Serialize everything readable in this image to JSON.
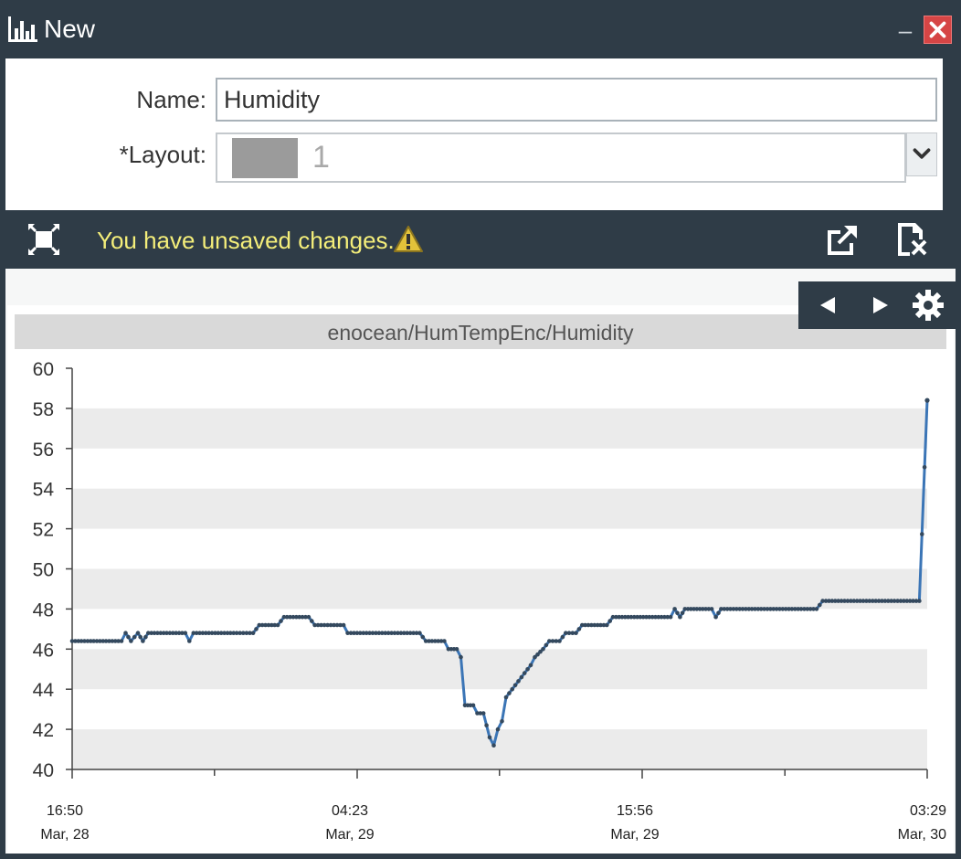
{
  "window": {
    "title": "New",
    "minimize_label": "–"
  },
  "form": {
    "name_label": "Name:",
    "name_value": "Humidity",
    "layout_label": "*Layout:",
    "layout_value": "1",
    "layout_swatch_color": "#9b9b9b"
  },
  "toolbar": {
    "unsaved_message": "You have unsaved changes."
  },
  "colors": {
    "chrome": "#2f3c47",
    "warning_text": "#f4ee7a",
    "close": "#d64545",
    "line": "#3b75b6",
    "point": "#34495e"
  },
  "icons": [
    "chart-icon",
    "close-icon",
    "expand-icon",
    "warning-icon",
    "export-icon",
    "discard-icon",
    "prev-icon",
    "next-icon",
    "gear-icon",
    "chevron-down-icon"
  ],
  "chart_data": {
    "type": "line",
    "title": "enocean/HumTempEnc/Humidity",
    "xlabel": "",
    "ylabel": "",
    "ylim": [
      40,
      60
    ],
    "yticks": [
      "40",
      "42",
      "44",
      "46",
      "48",
      "50",
      "52",
      "54",
      "56",
      "58",
      "60"
    ],
    "xlim": [
      "2024-03-28T16:50",
      "2024-03-30T03:29"
    ],
    "xticks": [
      {
        "time": "2024-03-28T16:50",
        "label": [
          "16:50",
          "Mar, 28"
        ]
      },
      {
        "time": "2024-03-29T04:23",
        "label": [
          "04:23",
          "Mar, 29"
        ]
      },
      {
        "time": "2024-03-29T15:56",
        "label": [
          "15:56",
          "Mar, 29"
        ]
      },
      {
        "time": "2024-03-30T03:29",
        "label": [
          "03:29",
          "Mar, 30"
        ]
      }
    ],
    "minor_xticks": [
      "2024-03-28T22:36",
      "2024-03-29T10:09",
      "2024-03-29T21:43"
    ],
    "grid": "alternating horizontal bands",
    "series": [
      {
        "points": [
          [
            "2024-03-28T16:50",
            46.4
          ],
          [
            "2024-03-28T18:50",
            46.4
          ],
          [
            "2024-03-28T19:00",
            46.8
          ],
          [
            "2024-03-28T19:13",
            46.4
          ],
          [
            "2024-03-28T19:30",
            46.8
          ],
          [
            "2024-03-28T19:42",
            46.4
          ],
          [
            "2024-03-28T19:55",
            46.8
          ],
          [
            "2024-03-28T21:25",
            46.8
          ],
          [
            "2024-03-28T21:35",
            46.4
          ],
          [
            "2024-03-28T21:45",
            46.8
          ],
          [
            "2024-03-28T23:30",
            46.8
          ],
          [
            "2024-03-29T00:10",
            46.8
          ],
          [
            "2024-03-29T00:25",
            47.2
          ],
          [
            "2024-03-29T01:10",
            47.2
          ],
          [
            "2024-03-29T01:25",
            47.6
          ],
          [
            "2024-03-29T02:25",
            47.6
          ],
          [
            "2024-03-29T02:40",
            47.2
          ],
          [
            "2024-03-29T03:50",
            47.2
          ],
          [
            "2024-03-29T04:00",
            46.8
          ],
          [
            "2024-03-29T06:55",
            46.8
          ],
          [
            "2024-03-29T07:10",
            46.4
          ],
          [
            "2024-03-29T07:55",
            46.4
          ],
          [
            "2024-03-29T08:05",
            46.0
          ],
          [
            "2024-03-29T08:25",
            46.0
          ],
          [
            "2024-03-29T08:35",
            45.6
          ],
          [
            "2024-03-29T08:45",
            43.2
          ],
          [
            "2024-03-29T09:05",
            43.2
          ],
          [
            "2024-03-29T09:15",
            42.8
          ],
          [
            "2024-03-29T09:30",
            42.8
          ],
          [
            "2024-03-29T09:45",
            41.6
          ],
          [
            "2024-03-29T09:55",
            41.2
          ],
          [
            "2024-03-29T10:05",
            42.0
          ],
          [
            "2024-03-29T10:15",
            42.4
          ],
          [
            "2024-03-29T10:25",
            43.6
          ],
          [
            "2024-03-29T10:40",
            44.0
          ],
          [
            "2024-03-29T10:55",
            44.4
          ],
          [
            "2024-03-29T11:10",
            44.8
          ],
          [
            "2024-03-29T11:25",
            45.2
          ],
          [
            "2024-03-29T11:35",
            45.6
          ],
          [
            "2024-03-29T11:55",
            46.0
          ],
          [
            "2024-03-29T12:10",
            46.4
          ],
          [
            "2024-03-29T12:35",
            46.4
          ],
          [
            "2024-03-29T12:50",
            46.8
          ],
          [
            "2024-03-29T13:15",
            46.8
          ],
          [
            "2024-03-29T13:30",
            47.2
          ],
          [
            "2024-03-29T14:30",
            47.2
          ],
          [
            "2024-03-29T14:45",
            47.6
          ],
          [
            "2024-03-29T17:05",
            47.6
          ],
          [
            "2024-03-29T17:15",
            48.0
          ],
          [
            "2024-03-29T17:28",
            47.6
          ],
          [
            "2024-03-29T17:40",
            48.0
          ],
          [
            "2024-03-29T18:45",
            48.0
          ],
          [
            "2024-03-29T18:55",
            47.6
          ],
          [
            "2024-03-29T19:08",
            48.0
          ],
          [
            "2024-03-29T23:00",
            48.0
          ],
          [
            "2024-03-29T23:15",
            48.4
          ],
          [
            "2024-03-30T03:10",
            48.4
          ],
          [
            "2024-03-30T03:29",
            58.4
          ]
        ]
      }
    ]
  }
}
